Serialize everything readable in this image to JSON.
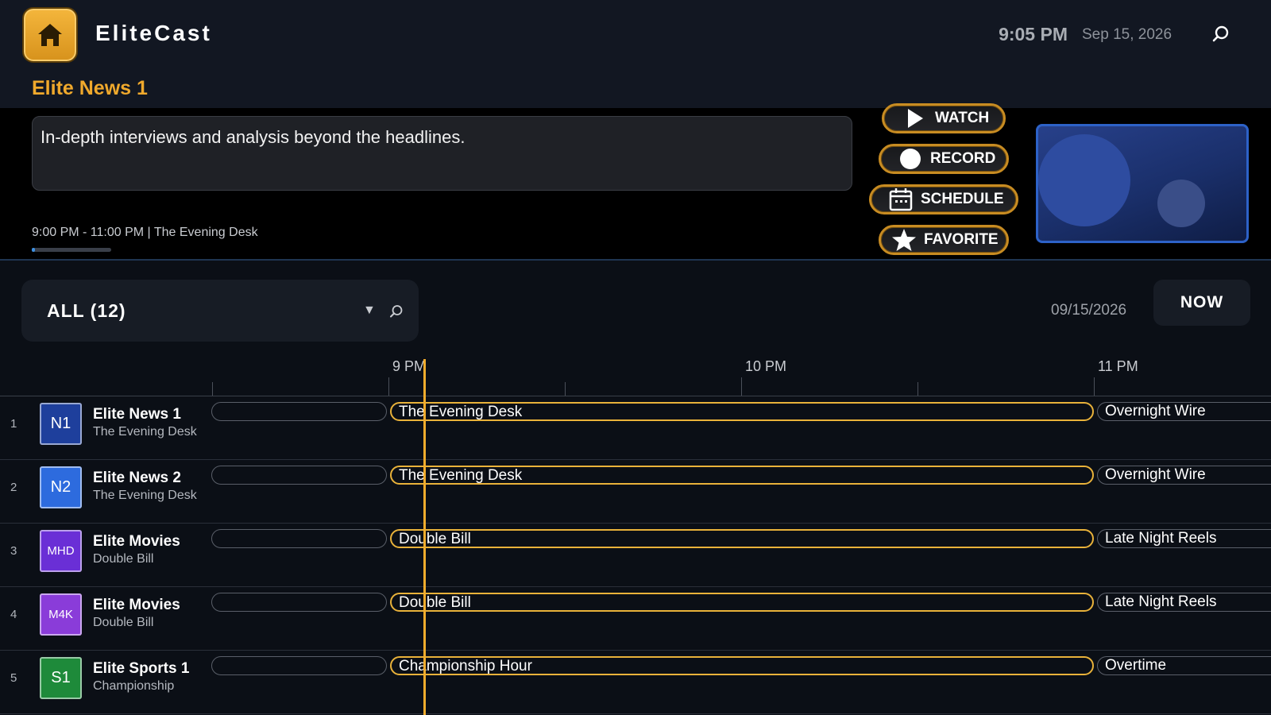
{
  "header": {
    "brand": "EliteCast",
    "time": "9:05 PM",
    "date": "Sep 15, 2026",
    "icons": [
      "home-icon",
      "search-icon"
    ]
  },
  "selected": {
    "channel_title": "Elite News 1",
    "description": "In-depth interviews and analysis beyond the headlines.",
    "time_info": "9:00 PM - 11:00 PM | The Evening Desk",
    "progress": 0.04
  },
  "actions": {
    "watch": "WATCH",
    "record": "RECORD",
    "schedule": "SCHEDULE",
    "favorite": "FAVORITE"
  },
  "filter": {
    "label": "ALL (12)",
    "date": "09/15/2026",
    "now_label": "NOW"
  },
  "timeline": {
    "labels": [
      "9 PM",
      "10 PM",
      "11 PM"
    ],
    "current_time": "9:05 PM"
  },
  "channels": [
    {
      "num": "1",
      "logo": "N1",
      "logo_color": "#1e3f9c",
      "name": "Elite News 1",
      "now": "The Evening Desk",
      "programs": {
        "current": "The Evening Desk",
        "next": "Overnight Wire"
      }
    },
    {
      "num": "2",
      "logo": "N2",
      "logo_color": "#2d6bde",
      "name": "Elite News 2",
      "now": "The Evening Desk",
      "programs": {
        "current": "The Evening Desk",
        "next": "Overnight Wire"
      }
    },
    {
      "num": "3",
      "logo": "MHD",
      "logo_color": "#6a2fd6",
      "name": "Elite Movies",
      "now": "Double Bill",
      "programs": {
        "current": "Double Bill",
        "next": "Late Night Reels"
      }
    },
    {
      "num": "4",
      "logo": "M4K",
      "logo_color": "#8a3cd9",
      "name": "Elite Movies",
      "now": "Double Bill",
      "programs": {
        "current": "Double Bill",
        "next": "Late Night Reels"
      }
    },
    {
      "num": "5",
      "logo": "S1",
      "logo_color": "#1e8a3a",
      "name": "Elite Sports 1",
      "now": "Championship",
      "programs": {
        "current": "Championship Hour",
        "next": "Overtime"
      }
    }
  ],
  "colors": {
    "accent": "#f0a92c",
    "background": "#0b0f16",
    "panel": "#171c25",
    "progress": "#3d8fe0"
  }
}
